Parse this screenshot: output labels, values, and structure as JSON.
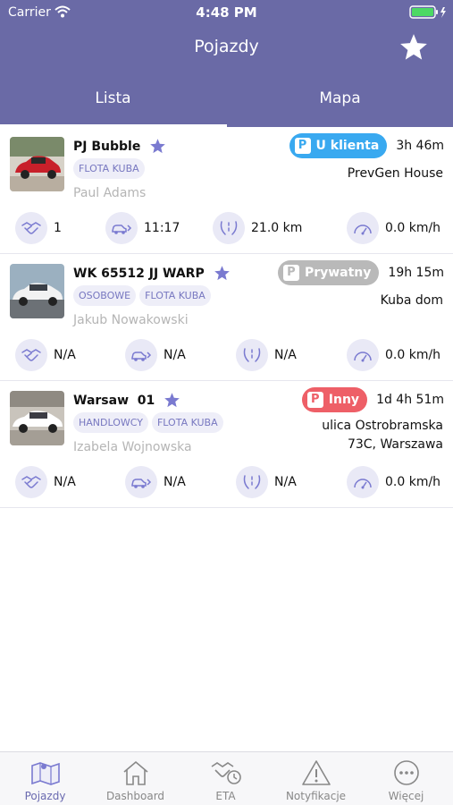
{
  "status_bar": {
    "carrier": "Carrier",
    "time": "4:48 PM"
  },
  "nav": {
    "title": "Pojazdy"
  },
  "tabs": [
    {
      "label": "Lista"
    },
    {
      "label": "Mapa"
    }
  ],
  "vehicles": [
    {
      "name": "PJ Bubble",
      "tags": [
        "FLOTA KUBA"
      ],
      "driver": "Paul Adams",
      "status": {
        "label": "U klienta",
        "color": "#39a9f0"
      },
      "duration": "3h 46m",
      "location": [
        "PrevGen House"
      ],
      "stats": {
        "trips": "1",
        "time": "11:17",
        "distance": "21.0 km",
        "speed": "0.0 km/h"
      }
    },
    {
      "name": "WK 65512 JJ WARP",
      "tags": [
        "OSOBOWE",
        "FLOTA KUBA"
      ],
      "driver": "Jakub Nowakowski",
      "status": {
        "label": "Prywatny",
        "color": "#b9b9b9"
      },
      "duration": "19h 15m",
      "location": [
        "Kuba dom"
      ],
      "stats": {
        "trips": "N/A",
        "time": "N/A",
        "distance": "N/A",
        "speed": "0.0 km/h"
      }
    },
    {
      "name": "Warsaw  01",
      "tags": [
        "HANDLOWCY",
        "FLOTA KUBA"
      ],
      "driver": "Izabela Wojnowska",
      "status": {
        "label": "Inny",
        "color": "#ee5f67"
      },
      "duration": "1d 4h 51m",
      "location": [
        "ulica Ostrobramska",
        "73C, Warszawa"
      ],
      "stats": {
        "trips": "N/A",
        "time": "N/A",
        "distance": "N/A",
        "speed": "0.0 km/h"
      }
    }
  ],
  "tabbar": [
    {
      "label": "Pojazdy",
      "icon": "map-icon"
    },
    {
      "label": "Dashboard",
      "icon": "home-icon"
    },
    {
      "label": "ETA",
      "icon": "handshake-clock-icon"
    },
    {
      "label": "Notyfikacje",
      "icon": "warning-icon"
    },
    {
      "label": "Więcej",
      "icon": "more-icon"
    }
  ],
  "colors": {
    "header": "#6a6aa6",
    "accent": "#6a6ab0",
    "star": "#7a7ad0"
  }
}
